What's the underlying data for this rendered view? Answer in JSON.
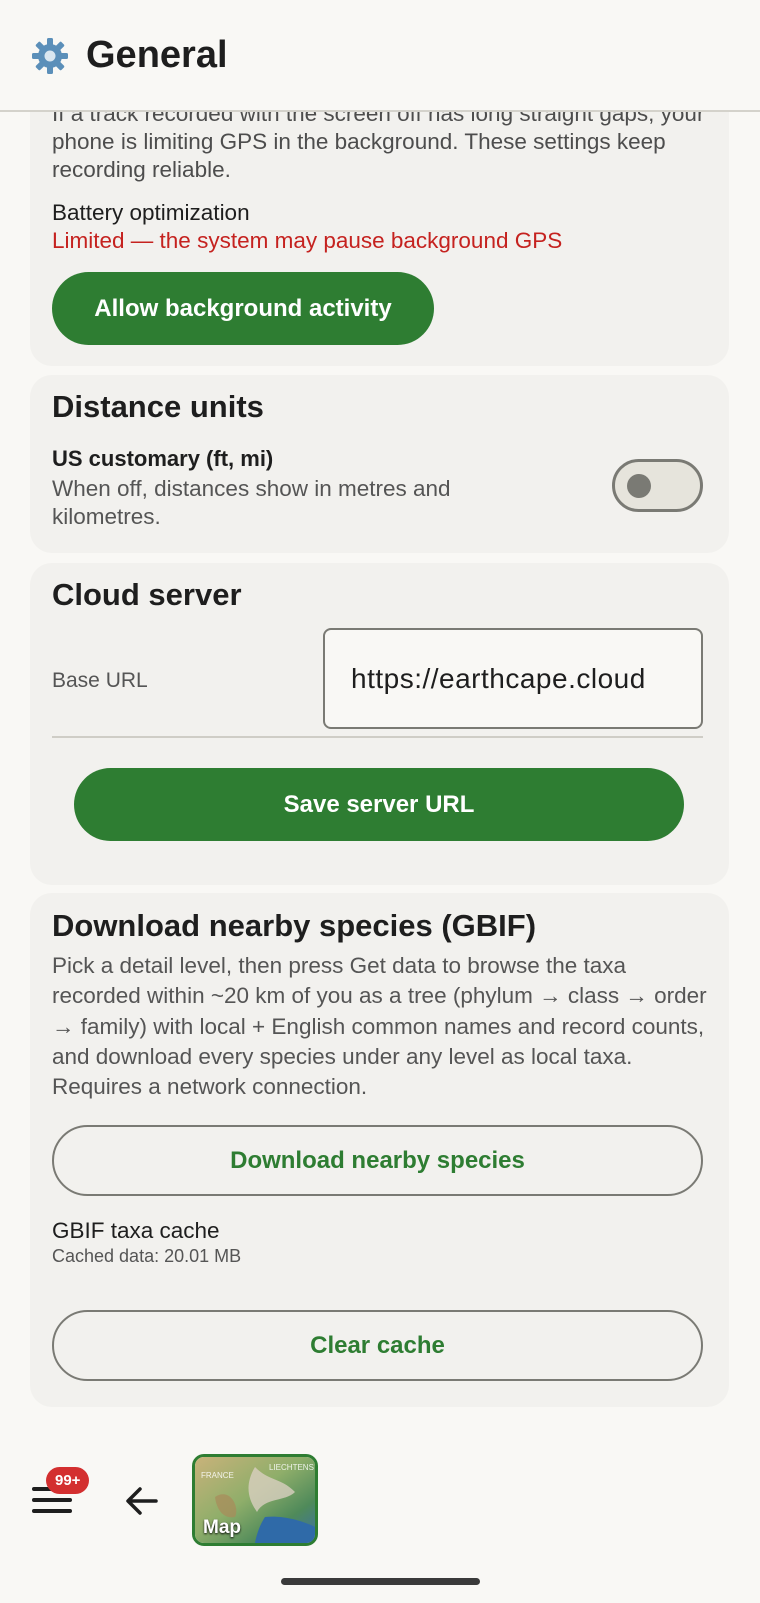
{
  "header": {
    "title": "General",
    "icon": "gear-icon",
    "icon_color": "#5b8fb9"
  },
  "background_card": {
    "intro": "If a track recorded with the screen off has long straight gaps, your phone is limiting GPS in the background. These settings keep recording reliable.",
    "battery_label": "Battery optimization",
    "battery_status": "Limited — the system may pause background GPS",
    "allow_button": "Allow background activity"
  },
  "units_card": {
    "title": "Distance units",
    "toggle_label": "US customary (ft, mi)",
    "toggle_description": "When off, distances show in metres and kilometres.",
    "toggle_on": false
  },
  "server_card": {
    "title": "Cloud server",
    "base_url_label": "Base URL",
    "base_url_value": "https://earthcape.cloud",
    "save_button": "Save server URL"
  },
  "gbif_card": {
    "title": "Download nearby species (GBIF)",
    "description": "Pick a detail level, then press Get data to browse the taxa recorded within ~20 km of you as a tree (phylum → class → order → family) with local + English common names and record counts, and download every species under any level as local taxa. Requires a network connection.",
    "download_button": "Download nearby species",
    "cache_label": "GBIF taxa cache",
    "cache_size": "Cached data: 20.01 MB",
    "clear_button": "Clear cache"
  },
  "bottom_nav": {
    "badge": "99+",
    "map_label": "Map",
    "map_labels_small": [
      "FRANCE",
      "LIECHTENS"
    ],
    "menu_icon": "hamburger-menu-icon",
    "back_icon": "back-arrow-icon"
  },
  "colors": {
    "accent": "#2e7d32",
    "warning": "#c5221f",
    "badge": "#d32f2f",
    "background": "#f9f8f5",
    "card": "#f2f1ee"
  }
}
